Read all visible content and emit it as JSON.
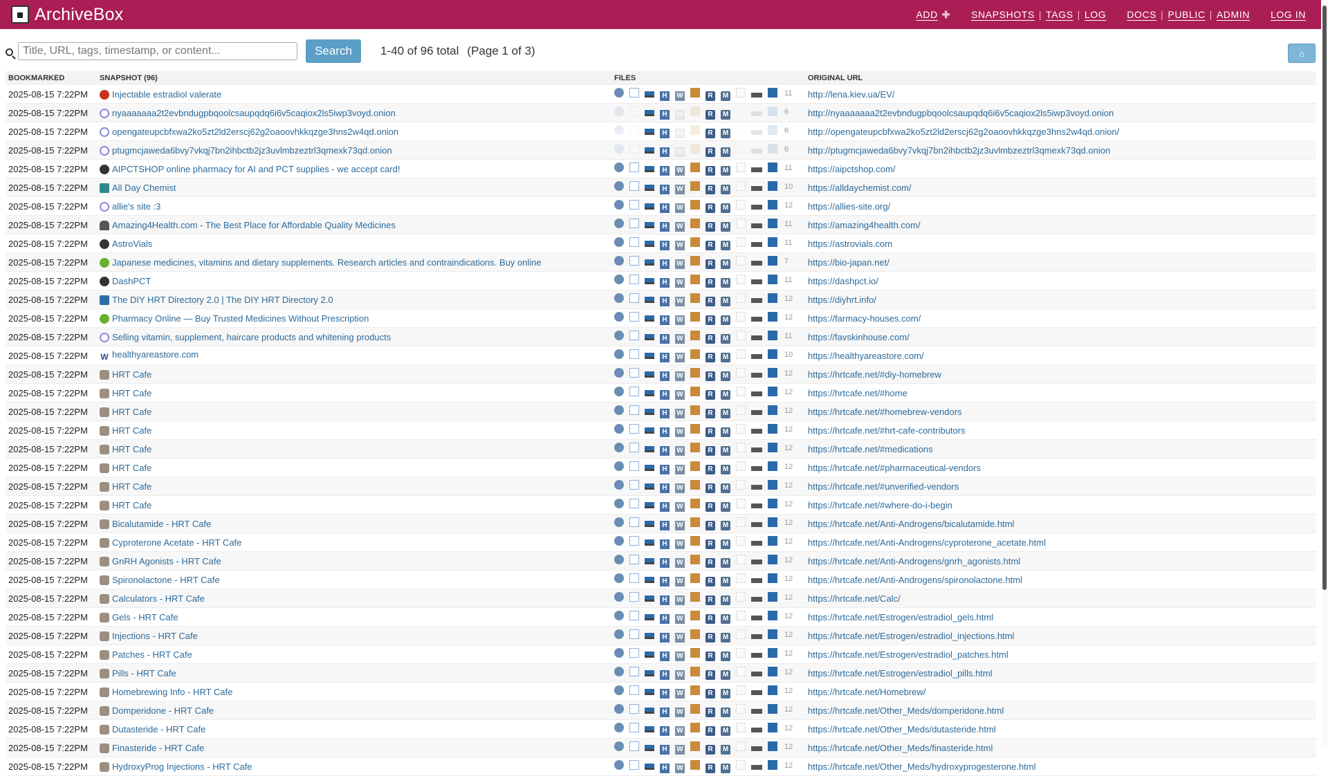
{
  "header": {
    "brand": "ArchiveBox",
    "nav": {
      "add": "ADD",
      "snapshots": "SNAPSHOTS",
      "tags": "TAGS",
      "log": "LOG",
      "docs": "DOCS",
      "public": "PUBLIC",
      "admin": "ADMIN",
      "login": "LOG IN"
    },
    "color": "#aa1e55"
  },
  "search": {
    "placeholder": "Title, URL, tags, timestamp, or content...",
    "button": "Search",
    "count": "1-40 of 96 total",
    "page": "(Page 1 of 3)"
  },
  "home_button": "⌂",
  "table": {
    "headers": {
      "bookmarked": "BOOKMARKED",
      "snapshot": "SNAPSHOT (96)",
      "files": "FILES",
      "url": "ORIGINAL URL"
    },
    "rows": [
      {
        "date": "2025-08-15 7:22PM",
        "title": "Injectable estradiol valerate",
        "icon": "red",
        "files": "11",
        "dim": false,
        "url": "http://lena.kiev.ua/EV/"
      },
      {
        "date": "2025-08-15 7:22PM",
        "title": "nyaaaaaaa2t2evbndugpbqoolcsaupqdq6i6v5caqiox2ls5iwp3voyd.onion",
        "icon": "purple",
        "files": "6",
        "dim": true,
        "url": "http://nyaaaaaaa2t2evbndugpbqoolcsaupqdq6i6v5caqiox2ls5iwp3voyd.onion"
      },
      {
        "date": "2025-08-15 7:22PM",
        "title": "opengateupcbfxwa2ko5zt2ld2erscj62g2oaoovhkkqzge3hns2w4qd.onion",
        "icon": "purple",
        "files": "6",
        "dim": true,
        "url": "http://opengateupcbfxwa2ko5zt2ld2erscj62g2oaoovhkkqzge3hns2w4qd.onion/"
      },
      {
        "date": "2025-08-15 7:22PM",
        "title": "ptugmcjaweda6bvy7vkqj7bn2ihbctb2jz3uvlmbzeztrl3qmexk73qd.onion",
        "icon": "purple",
        "files": "6",
        "dim": true,
        "url": "http://ptugmcjaweda6bvy7vkqj7bn2ihbctb2jz3uvlmbzeztrl3qmexk73qd.onion"
      },
      {
        "date": "2025-08-15 7:22PM",
        "title": "AIPCTSHOP online pharmacy for AI and PCT supplies - we accept card!",
        "icon": "dark",
        "files": "11",
        "dim": false,
        "url": "https://aipctshop.com/"
      },
      {
        "date": "2025-08-15 7:22PM",
        "title": "All Day Chemist",
        "icon": "teal",
        "files": "10",
        "dim": false,
        "url": "https://alldaychemist.com/"
      },
      {
        "date": "2025-08-15 7:22PM",
        "title": "allie's site :3",
        "icon": "purple",
        "files": "12",
        "dim": false,
        "url": "https://allies-site.org/"
      },
      {
        "date": "2025-08-15 7:22PM",
        "title": "Amazing4Health.com - The Best Place for Affordable Quality Medicines",
        "icon": "person",
        "files": "11",
        "dim": false,
        "url": "https://amazing4health.com/"
      },
      {
        "date": "2025-08-15 7:22PM",
        "title": "AstroVials",
        "icon": "dark",
        "files": "11",
        "dim": false,
        "url": "https://astrovials.com"
      },
      {
        "date": "2025-08-15 7:22PM",
        "title": "Japanese medicines, vitamins and dietary supplements. Research articles and contraindications. Buy online",
        "icon": "green",
        "files": "7",
        "dim": false,
        "url": "https://bio-japan.net/"
      },
      {
        "date": "2025-08-15 7:22PM",
        "title": "DashPCT",
        "icon": "dark",
        "files": "11",
        "dim": false,
        "url": "https://dashpct.io/"
      },
      {
        "date": "2025-08-15 7:22PM",
        "title": "The DIY HRT Directory 2.0 | The DIY HRT Directory 2.0",
        "icon": "blue",
        "files": "12",
        "dim": false,
        "url": "https://diyhrt.info/"
      },
      {
        "date": "2025-08-15 7:22PM",
        "title": "Pharmacy Online — Buy Trusted Medicines Without Prescription",
        "icon": "green",
        "files": "12",
        "dim": false,
        "url": "https://farmacy-houses.com/"
      },
      {
        "date": "2025-08-15 7:22PM",
        "title": "Selling vitamin, supplement, haircare products and whitening products",
        "icon": "purple",
        "files": "11",
        "dim": false,
        "url": "https://favskinhouse.com/"
      },
      {
        "date": "2025-08-15 7:22PM",
        "title": "healthyareastore.com",
        "icon": "w",
        "files": "10",
        "dim": false,
        "url": "https://healthyareastore.com/"
      },
      {
        "date": "2025-08-15 7:22PM",
        "title": "HRT Cafe",
        "icon": "cup",
        "files": "12",
        "dim": false,
        "url": "https://hrtcafe.net/#diy-homebrew"
      },
      {
        "date": "2025-08-15 7:22PM",
        "title": "HRT Cafe",
        "icon": "cup",
        "files": "12",
        "dim": false,
        "url": "https://hrtcafe.net/#home"
      },
      {
        "date": "2025-08-15 7:22PM",
        "title": "HRT Cafe",
        "icon": "cup",
        "files": "12",
        "dim": false,
        "url": "https://hrtcafe.net/#homebrew-vendors"
      },
      {
        "date": "2025-08-15 7:22PM",
        "title": "HRT Cafe",
        "icon": "cup",
        "files": "12",
        "dim": false,
        "url": "https://hrtcafe.net/#hrt-cafe-contributors"
      },
      {
        "date": "2025-08-15 7:22PM",
        "title": "HRT Cafe",
        "icon": "cup",
        "files": "12",
        "dim": false,
        "url": "https://hrtcafe.net/#medications"
      },
      {
        "date": "2025-08-15 7:22PM",
        "title": "HRT Cafe",
        "icon": "cup",
        "files": "12",
        "dim": false,
        "url": "https://hrtcafe.net/#pharmaceutical-vendors"
      },
      {
        "date": "2025-08-15 7:22PM",
        "title": "HRT Cafe",
        "icon": "cup",
        "files": "12",
        "dim": false,
        "url": "https://hrtcafe.net/#unverified-vendors"
      },
      {
        "date": "2025-08-15 7:22PM",
        "title": "HRT Cafe",
        "icon": "cup",
        "files": "12",
        "dim": false,
        "url": "https://hrtcafe.net/#where-do-i-begin"
      },
      {
        "date": "2025-08-15 7:22PM",
        "title": "Bicalutamide - HRT Cafe",
        "icon": "cup",
        "files": "12",
        "dim": false,
        "url": "https://hrtcafe.net/Anti-Androgens/bicalutamide.html"
      },
      {
        "date": "2025-08-15 7:22PM",
        "title": "Cyproterone Acetate - HRT Cafe",
        "icon": "cup",
        "files": "12",
        "dim": false,
        "url": "https://hrtcafe.net/Anti-Androgens/cyproterone_acetate.html"
      },
      {
        "date": "2025-08-15 7:22PM",
        "title": "GnRH Agonists - HRT Cafe",
        "icon": "cup",
        "files": "12",
        "dim": false,
        "url": "https://hrtcafe.net/Anti-Androgens/gnrh_agonists.html"
      },
      {
        "date": "2025-08-15 7:22PM",
        "title": "Spironolactone - HRT Cafe",
        "icon": "cup",
        "files": "12",
        "dim": false,
        "url": "https://hrtcafe.net/Anti-Androgens/spironolactone.html"
      },
      {
        "date": "2025-08-15 7:22PM",
        "title": "Calculators - HRT Cafe",
        "icon": "cup",
        "files": "12",
        "dim": false,
        "url": "https://hrtcafe.net/Calc/"
      },
      {
        "date": "2025-08-15 7:22PM",
        "title": "Gels - HRT Cafe",
        "icon": "cup",
        "files": "12",
        "dim": false,
        "url": "https://hrtcafe.net/Estrogen/estradiol_gels.html"
      },
      {
        "date": "2025-08-15 7:22PM",
        "title": "Injections - HRT Cafe",
        "icon": "cup",
        "files": "12",
        "dim": false,
        "url": "https://hrtcafe.net/Estrogen/estradiol_injections.html"
      },
      {
        "date": "2025-08-15 7:22PM",
        "title": "Patches - HRT Cafe",
        "icon": "cup",
        "files": "12",
        "dim": false,
        "url": "https://hrtcafe.net/Estrogen/estradiol_patches.html"
      },
      {
        "date": "2025-08-15 7:22PM",
        "title": "Pills - HRT Cafe",
        "icon": "cup",
        "files": "12",
        "dim": false,
        "url": "https://hrtcafe.net/Estrogen/estradiol_pills.html"
      },
      {
        "date": "2025-08-15 7:22PM",
        "title": "Homebrewing Info - HRT Cafe",
        "icon": "cup",
        "files": "12",
        "dim": false,
        "url": "https://hrtcafe.net/Homebrew/"
      },
      {
        "date": "2025-08-15 7:22PM",
        "title": "Domperidone - HRT Cafe",
        "icon": "cup",
        "files": "12",
        "dim": false,
        "url": "https://hrtcafe.net/Other_Meds/domperidone.html"
      },
      {
        "date": "2025-08-15 7:22PM",
        "title": "Dutasteride - HRT Cafe",
        "icon": "cup",
        "files": "12",
        "dim": false,
        "url": "https://hrtcafe.net/Other_Meds/dutasteride.html"
      },
      {
        "date": "2025-08-15 7:22PM",
        "title": "Finasteride - HRT Cafe",
        "icon": "cup",
        "files": "12",
        "dim": false,
        "url": "https://hrtcafe.net/Other_Meds/finasteride.html"
      },
      {
        "date": "2025-08-15 7:22PM",
        "title": "HydroxyProg Injections - HRT Cafe",
        "icon": "cup",
        "files": "12",
        "dim": false,
        "url": "https://hrtcafe.net/Other_Meds/hydroxyprogesterone.html"
      }
    ]
  }
}
